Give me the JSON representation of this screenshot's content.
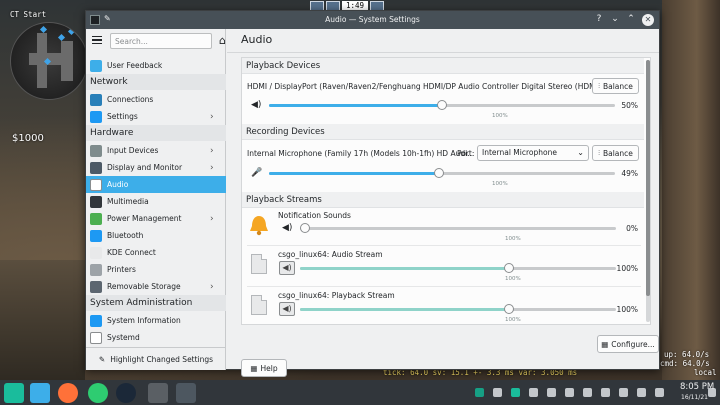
{
  "game": {
    "ct_start": "CT Start",
    "money": "$1000",
    "timer": "1:49",
    "netgraph": "tick: 64.0  sv: 15.1 +- 3.3 ms  var: 3.050 ms",
    "rate_up": "up: 64.0/s",
    "rate_cmd": "cmd: 64.0/s",
    "local": "local"
  },
  "window": {
    "title": "Audio — System Settings",
    "help_btn": "?",
    "min_btn": "⌄",
    "max_btn": "⌃",
    "close_btn": "✕"
  },
  "sidebar": {
    "search_placeholder": "Search...",
    "items": [
      {
        "label": "User Feedback",
        "icon_color": "#3daee9"
      },
      {
        "category": "Network"
      },
      {
        "label": "Connections",
        "icon_color": "#2980b9"
      },
      {
        "label": "Settings",
        "icon_color": "#1d99f3",
        "chevron": "›"
      },
      {
        "category": "Hardware"
      },
      {
        "label": "Input Devices",
        "icon_color": "#7f8c8d",
        "chevron": "›"
      },
      {
        "label": "Display and Monitor",
        "icon_color": "#4d5a66",
        "chevron": "›"
      },
      {
        "label": "Audio",
        "icon_color": "#ffffff",
        "selected": true
      },
      {
        "label": "Multimedia",
        "icon_color": "#31363b"
      },
      {
        "label": "Power Management",
        "icon_color": "#4caf50",
        "chevron": "›"
      },
      {
        "label": "Bluetooth",
        "icon_color": "#1d99f3"
      },
      {
        "label": "KDE Connect",
        "icon_color": "#e8e9ea"
      },
      {
        "label": "Printers",
        "icon_color": "#9da3a8"
      },
      {
        "label": "Removable Storage",
        "icon_color": "#5c6670",
        "chevron": "›"
      },
      {
        "category": "System Administration"
      },
      {
        "label": "System Information",
        "icon_color": "#1d99f3"
      },
      {
        "label": "Systemd",
        "icon_color": "#ffffff"
      }
    ],
    "footer": "Highlight Changed Settings"
  },
  "main": {
    "title": "Audio",
    "playback_devices": {
      "heading": "Playback Devices",
      "device": "HDMI / DisplayPort (Raven/Raven2/Fenghuang HDMI/DP Audio Controller Digital Stereo (HDMI))",
      "balance": "Balance",
      "volume": 50,
      "volume_text": "50%",
      "mark": "100%"
    },
    "recording_devices": {
      "heading": "Recording Devices",
      "device": "Internal Microphone (Family 17h (Models 10h-1fh) HD Audi...",
      "port_label": "Port:",
      "port_value": "Internal Microphone",
      "balance": "Balance",
      "volume": 49,
      "volume_text": "49%",
      "mark": "100%"
    },
    "playback_streams": {
      "heading": "Playback Streams",
      "streams": [
        {
          "name": "Notification Sounds",
          "volume": 0,
          "volume_text": "0%",
          "mark": "100%"
        },
        {
          "name": "csgo_linux64: Audio Stream",
          "volume": 100,
          "volume_text": "100%",
          "mark": "100%"
        },
        {
          "name": "csgo_linux64: Playback Stream",
          "volume": 100,
          "volume_text": "100%",
          "mark": "100%"
        }
      ]
    },
    "configure_btn": "Configure...",
    "help_btn": "Help"
  },
  "taskbar": {
    "time": "8:05 PM",
    "date": "16/11/21"
  },
  "colors": {
    "accent": "#3daee9",
    "stream_fill": "#8fd3c9",
    "titlebar": "#475057",
    "taskbar": "#31363b"
  }
}
